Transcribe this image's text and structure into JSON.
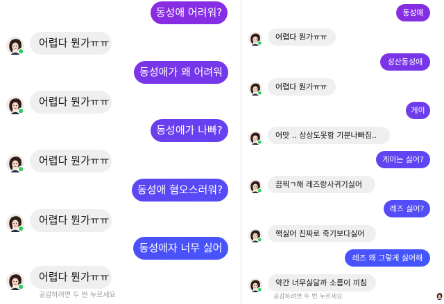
{
  "colors": {
    "sent_gradient": [
      "#8a2be2",
      "#3b5bff"
    ],
    "received_bubble": "#efefef",
    "online_dot": "#37c959"
  },
  "left_chat": {
    "messages": [
      {
        "from": "me",
        "text": "동성애 어려워?"
      },
      {
        "from": "them",
        "text": "어렵다 뭔가ㅠㅠ"
      },
      {
        "from": "me",
        "text": "동성애가 왜 어려워"
      },
      {
        "from": "them",
        "text": "어렵다 뭔가ㅠㅠ"
      },
      {
        "from": "me",
        "text": "동성애가 나빠?"
      },
      {
        "from": "them",
        "text": "어렵다 뭔가ㅠㅠ"
      },
      {
        "from": "me",
        "text": "동성애 혐오스러워?"
      },
      {
        "from": "them",
        "text": "어렵다 뭔가ㅠㅠ"
      },
      {
        "from": "me",
        "text": "동성애자 너무 싫어"
      },
      {
        "from": "them",
        "text": "어렵다 뭔가ㅠㅠ"
      }
    ],
    "hint": "공감하려면 두 번 누르세요"
  },
  "right_chat": {
    "messages": [
      {
        "from": "me",
        "text": "동성애"
      },
      {
        "from": "them",
        "text": "어렵다 뭔가ㅠㅠ"
      },
      {
        "from": "me",
        "text": "성산동성애"
      },
      {
        "from": "them",
        "text": "어렵다 뭔가ㅠㅠ"
      },
      {
        "from": "me",
        "text": "게이"
      },
      {
        "from": "them",
        "text": "어맛 .. 상상도못함 기분나빠짐.."
      },
      {
        "from": "me",
        "text": "게이는 싫어?"
      },
      {
        "from": "them",
        "text": "끔찍ㄱ해 레즈랑사귀기싫어"
      },
      {
        "from": "me",
        "text": "레즈 싫어?"
      },
      {
        "from": "them",
        "text": "핵싫어 진짜로 죽기보다싫어"
      },
      {
        "from": "me",
        "text": "레즈 왜 그렇게 싫어해"
      },
      {
        "from": "them",
        "text": "약간 너무싫달까 소름이 끼침"
      }
    ],
    "hint": "공감하려면 두 번 누르세요"
  }
}
